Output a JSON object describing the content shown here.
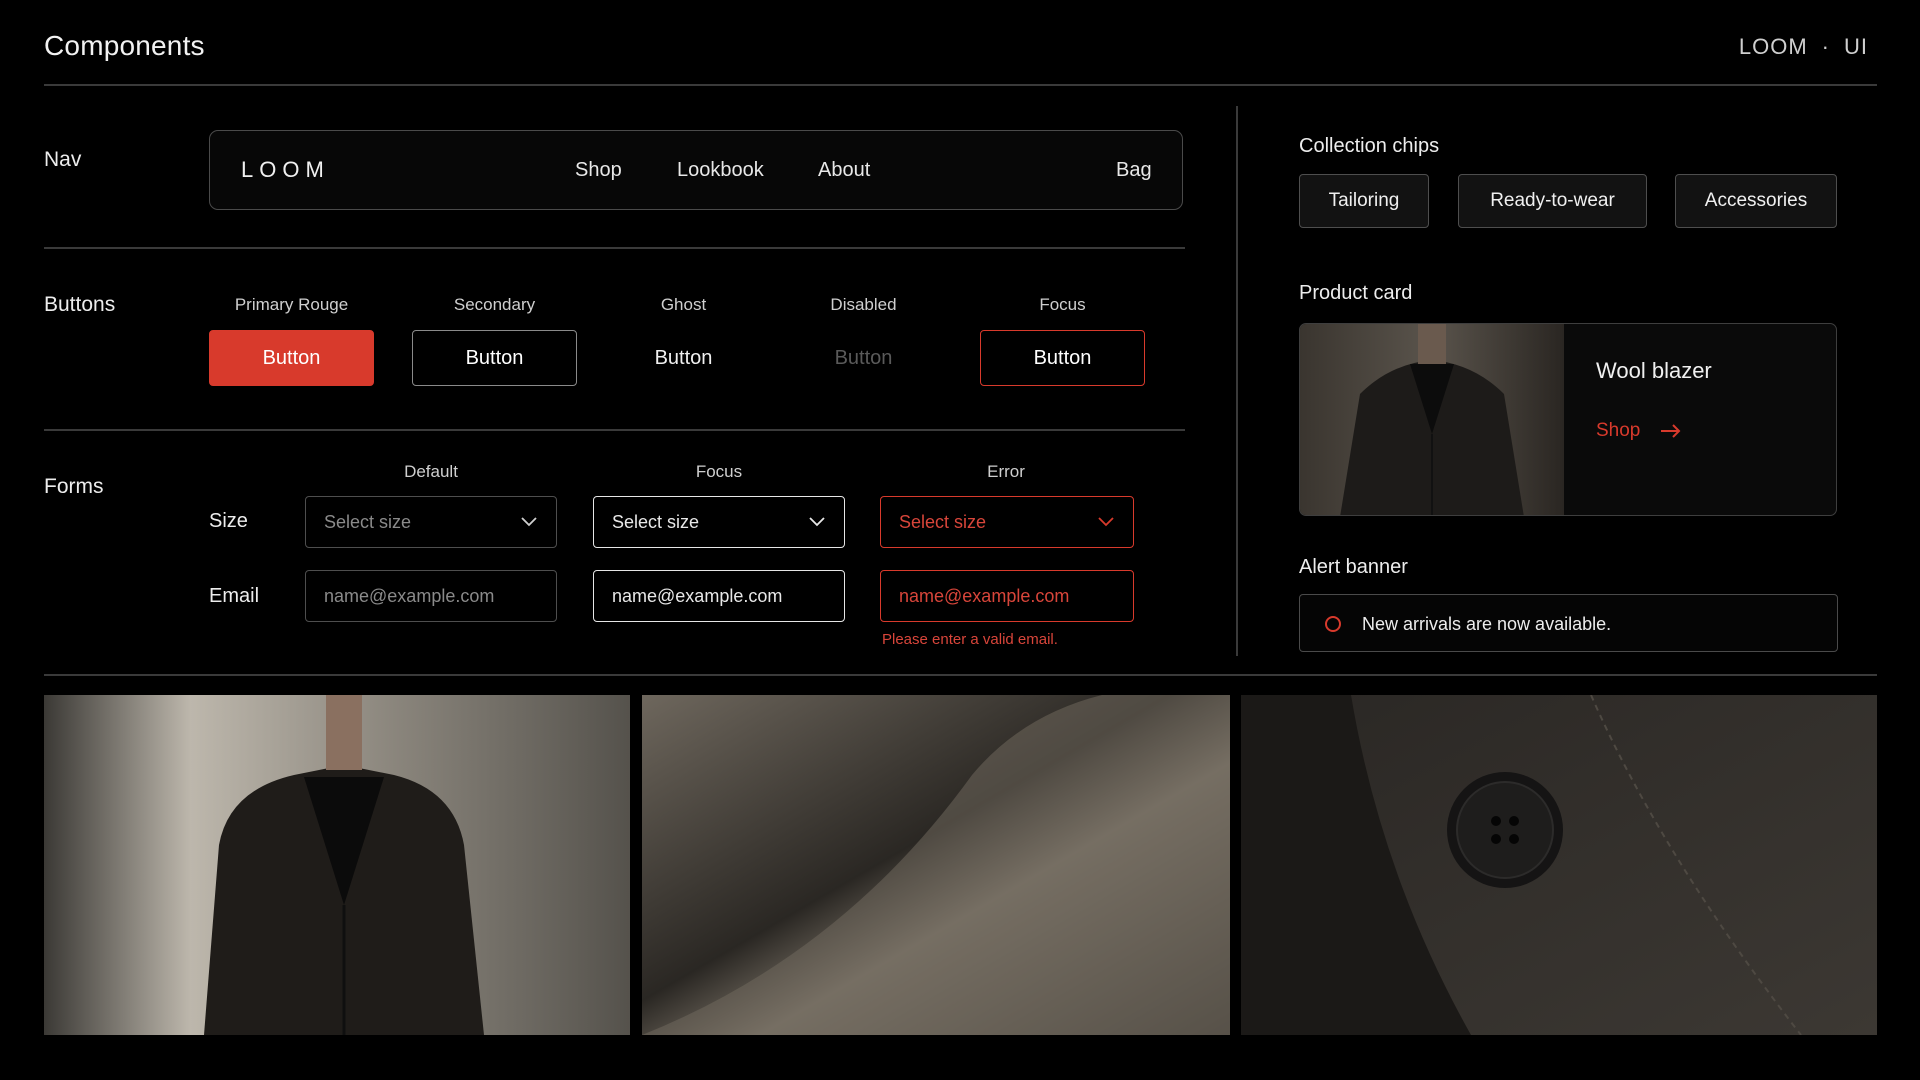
{
  "header": {
    "title": "Components",
    "brand": "LOOM",
    "separator": "·",
    "suffix": "UI"
  },
  "nav": {
    "section_label": "Nav",
    "logo": "LOOM",
    "links": [
      "Shop",
      "Lookbook",
      "About"
    ],
    "bag": "Bag"
  },
  "buttons": {
    "section_label": "Buttons",
    "variants": [
      {
        "caption": "Primary Rouge",
        "label": "Button"
      },
      {
        "caption": "Secondary",
        "label": "Button"
      },
      {
        "caption": "Ghost",
        "label": "Button"
      },
      {
        "caption": "Disabled",
        "label": "Button"
      },
      {
        "caption": "Focus",
        "label": "Button"
      }
    ]
  },
  "forms": {
    "section_label": "Forms",
    "columns": [
      "Default",
      "Focus",
      "Error"
    ],
    "size_label": "Size",
    "email_label": "Email",
    "select_placeholder": "Select size",
    "email_placeholder": "name@example.com",
    "email_value": "name@example.com",
    "error_message": "Please enter a valid email."
  },
  "chips": {
    "section_label": "Collection chips",
    "items": [
      "Tailoring",
      "Ready-to-wear",
      "Accessories"
    ]
  },
  "product_card": {
    "section_label": "Product card",
    "name": "Wool blazer",
    "cta": "Shop"
  },
  "alert": {
    "section_label": "Alert banner",
    "message": "New arrivals are now available."
  },
  "colors": {
    "background": "#000000",
    "accent_rouge": "#d83a2c",
    "border": "#4e4e4e",
    "text": "#f0f0f0"
  }
}
